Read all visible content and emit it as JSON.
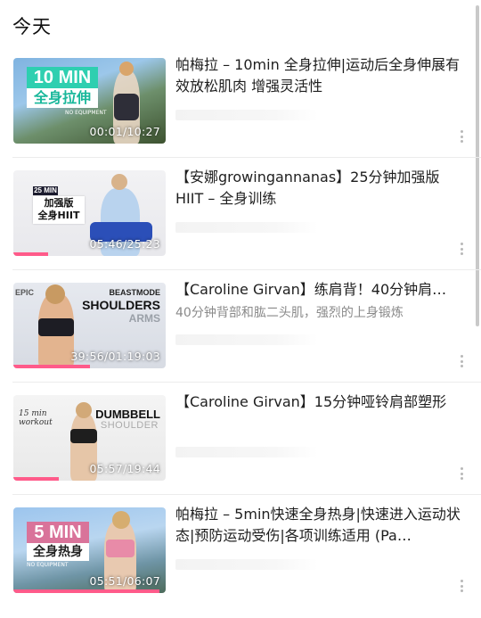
{
  "header": {
    "title": "今天"
  },
  "videos": [
    {
      "title": "帕梅拉 – 10min 全身拉伸|运动后全身伸展有效放松肌肉 增强灵活性",
      "subtitle": "",
      "duration": "00:01/10:27",
      "progress": 0.0,
      "thumb": {
        "badge": "10 MIN",
        "badge_color": "#2ecfb0",
        "caption": "全身拉伸",
        "sub": "NO EQUIPMENT"
      }
    },
    {
      "title": "【安娜growingannanas】25分钟加强版HIIT – 全身训练",
      "subtitle": "",
      "duration": "05:46/25:23",
      "progress": 0.23,
      "thumb": {
        "badge": "25 MIN",
        "badge_color": "#1b1b2e",
        "caption": "加强版\n全身HIIT"
      }
    },
    {
      "title": "【Caroline Girvan】练肩背！40分钟肩…",
      "subtitle": "40分钟背部和肱二头肌，强烈的上身锻炼",
      "duration": "39:56/01:19:03",
      "progress": 0.5,
      "thumb": {
        "line1": "BEASTMODE",
        "line2": "SHOULDERS",
        "line3": "ARMS",
        "logo": "EPIC"
      }
    },
    {
      "title": "【Caroline Girvan】15分钟哑铃肩部塑形",
      "subtitle": "",
      "duration": "05:57/19:44",
      "progress": 0.3,
      "thumb": {
        "line1": "DUMBBELL",
        "line2": "SHOULDER",
        "script": "15 min\nworkout"
      }
    },
    {
      "title": "帕梅拉 – 5min快速全身热身|快速进入运动状态|预防运动受伤|各项训练适用 (Pa…",
      "subtitle": "",
      "duration": "05:51/06:07",
      "progress": 0.96,
      "thumb": {
        "badge": "5 MIN",
        "badge_color": "#d9739a",
        "caption": "全身热身",
        "sub": "NO EQUIPMENT"
      }
    }
  ],
  "colors": {
    "progress": "#ff5b8a",
    "divider": "#ececec",
    "secondary_text": "#8a8a8a"
  }
}
